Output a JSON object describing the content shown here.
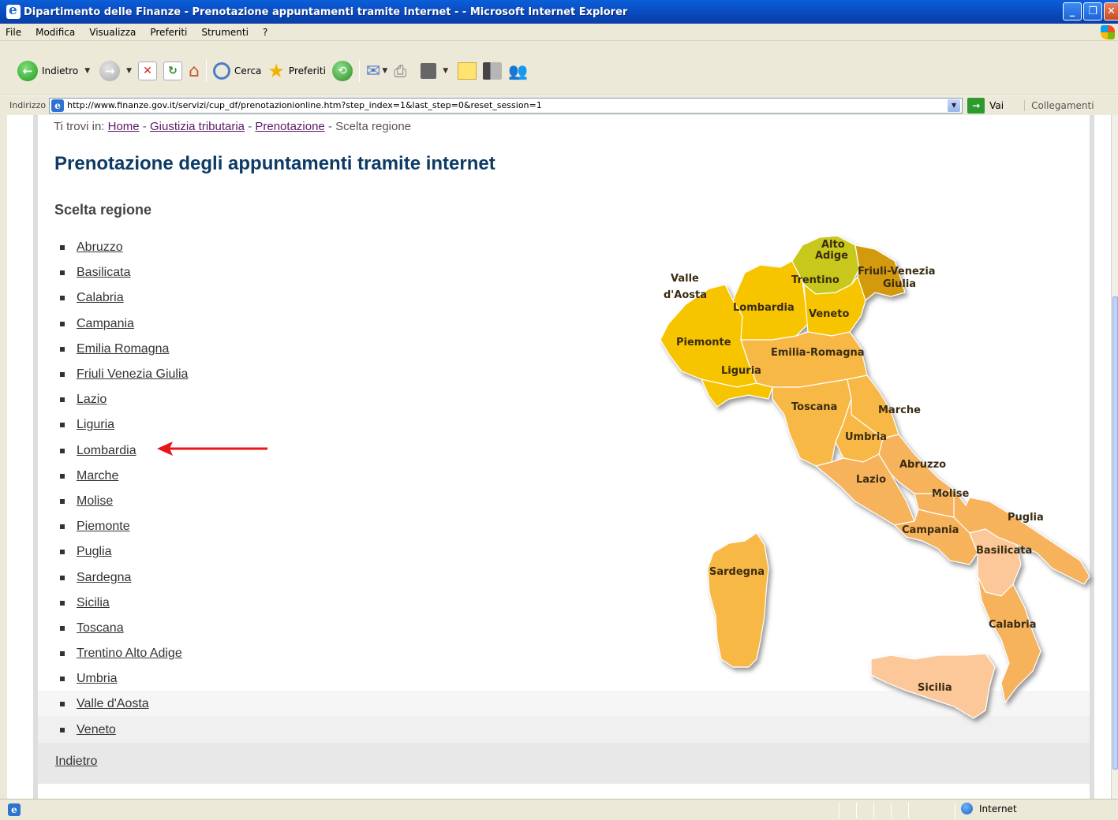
{
  "window": {
    "title": "Dipartimento delle Finanze - Prenotazione appuntamenti tramite Internet - - Microsoft Internet Explorer"
  },
  "menu": [
    "File",
    "Modifica",
    "Visualizza",
    "Preferiti",
    "Strumenti",
    "?"
  ],
  "toolbar": {
    "back_label": "Indietro",
    "search_label": "Cerca",
    "favorites_label": "Preferiti"
  },
  "address": {
    "label": "Indirizzo",
    "url": "http://www.finanze.gov.it/servizi/cup_df/prenotazionionline.htm?step_index=1&last_step=0&reset_session=1",
    "go_label": "Vai",
    "links_label": "Collegamenti"
  },
  "breadcrumb": {
    "prefix": "Ti trovi in: ",
    "home": "Home",
    "giustizia": "Giustizia tributaria",
    "prenotazione": "Prenotazione",
    "current": "Scelta regione",
    "sep": " - "
  },
  "page": {
    "title": "Prenotazione degli appuntamenti tramite internet",
    "section_title": "Scelta regione",
    "regions": [
      "Abruzzo",
      "Basilicata",
      "Calabria",
      "Campania",
      "Emilia Romagna",
      "Friuli Venezia Giulia",
      "Lazio",
      "Liguria",
      "Lombardia",
      "Marche",
      "Molise",
      "Piemonte",
      "Puglia",
      "Sardegna",
      "Sicilia",
      "Toscana",
      "Trentino Alto Adige",
      "Umbria",
      "Valle d'Aosta",
      "Veneto"
    ],
    "back_link": "Indietro"
  },
  "map": {
    "labels": {
      "alto_adige_1": "Alto",
      "alto_adige_2": "Adige",
      "trentino": "Trentino",
      "friuli_1": "Friuli-Venezia",
      "friuli_2": "Giulia",
      "valle_1": "Valle",
      "valle_2": "d'Aosta",
      "lombardia": "Lombardia",
      "veneto": "Veneto",
      "piemonte": "Piemonte",
      "emilia": "Emilia-Romagna",
      "liguria": "Liguria",
      "toscana": "Toscana",
      "marche": "Marche",
      "umbria": "Umbria",
      "abruzzo": "Abruzzo",
      "lazio": "Lazio",
      "molise": "Molise",
      "puglia": "Puglia",
      "campania": "Campania",
      "basilicata": "Basilicata",
      "sardegna": "Sardegna",
      "calabria": "Calabria",
      "sicilia": "Sicilia"
    },
    "colors": {
      "north": "#f7c400",
      "center": "#f8b844",
      "south": "#f6b35c",
      "pale": "#fcc899",
      "trentino": "#c8c81e",
      "friuli": "#d49a10"
    }
  },
  "status": {
    "zone": "Internet"
  }
}
